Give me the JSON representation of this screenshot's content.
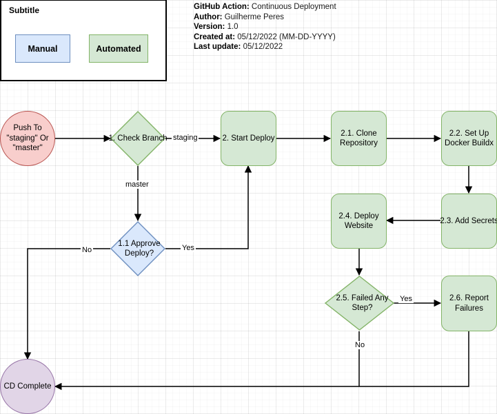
{
  "legend": {
    "title": "Subtitle",
    "manual_label": "Manual",
    "automated_label": "Automated",
    "manual_color": "#dae8fc",
    "manual_border": "#6c8ebf",
    "automated_color": "#d5e8d4",
    "automated_border": "#82b366"
  },
  "meta": {
    "action_key": "GitHub Action:",
    "action_value": "Continuous Deployment",
    "author_key": "Author:",
    "author_value": "Guilherme Peres",
    "version_key": "Version:",
    "version_value": "1.0",
    "created_key": "Created at:",
    "created_value": "05/12/2022 (MM-DD-YYYY)",
    "updated_key": "Last update:",
    "updated_value": "05/12/2022"
  },
  "nodes": {
    "start": {
      "label": "Push To \"staging\" Or \"master\"",
      "shape": "circle",
      "fill": "#f8cecc",
      "stroke": "#b85450"
    },
    "check_branch": {
      "label": "1. Check Branch",
      "shape": "diamond",
      "fill": "#d5e8d4",
      "stroke": "#82b366"
    },
    "approve_deploy": {
      "label": "1.1 Approve Deploy?",
      "shape": "diamond",
      "fill": "#dae8fc",
      "stroke": "#6c8ebf"
    },
    "start_deploy": {
      "label": "2. Start Deploy",
      "shape": "box",
      "fill": "#d5e8d4",
      "stroke": "#82b366"
    },
    "clone_repo": {
      "label": "2.1. Clone Repository",
      "shape": "box",
      "fill": "#d5e8d4",
      "stroke": "#82b366"
    },
    "docker_buildx": {
      "label": "2.2. Set Up Docker Buildx",
      "shape": "box",
      "fill": "#d5e8d4",
      "stroke": "#82b366"
    },
    "add_secrets": {
      "label": "2.3. Add Secrets",
      "shape": "box",
      "fill": "#d5e8d4",
      "stroke": "#82b366"
    },
    "deploy_website": {
      "label": "2.4. Deploy Website",
      "shape": "box",
      "fill": "#d5e8d4",
      "stroke": "#82b366"
    },
    "failed_any_step": {
      "label": "2.5. Failed Any Step?",
      "shape": "diamond",
      "fill": "#d5e8d4",
      "stroke": "#82b366"
    },
    "report_failures": {
      "label": "2.6. Report Failures",
      "shape": "box",
      "fill": "#d5e8d4",
      "stroke": "#82b366"
    },
    "cd_complete": {
      "label": "CD Complete",
      "shape": "circle",
      "fill": "#e1d5e7",
      "stroke": "#9673a6"
    }
  },
  "edge_labels": {
    "staging": "staging",
    "master": "master",
    "approve_yes": "Yes",
    "approve_no": "No",
    "failed_yes": "Yes",
    "failed_no": "No"
  }
}
